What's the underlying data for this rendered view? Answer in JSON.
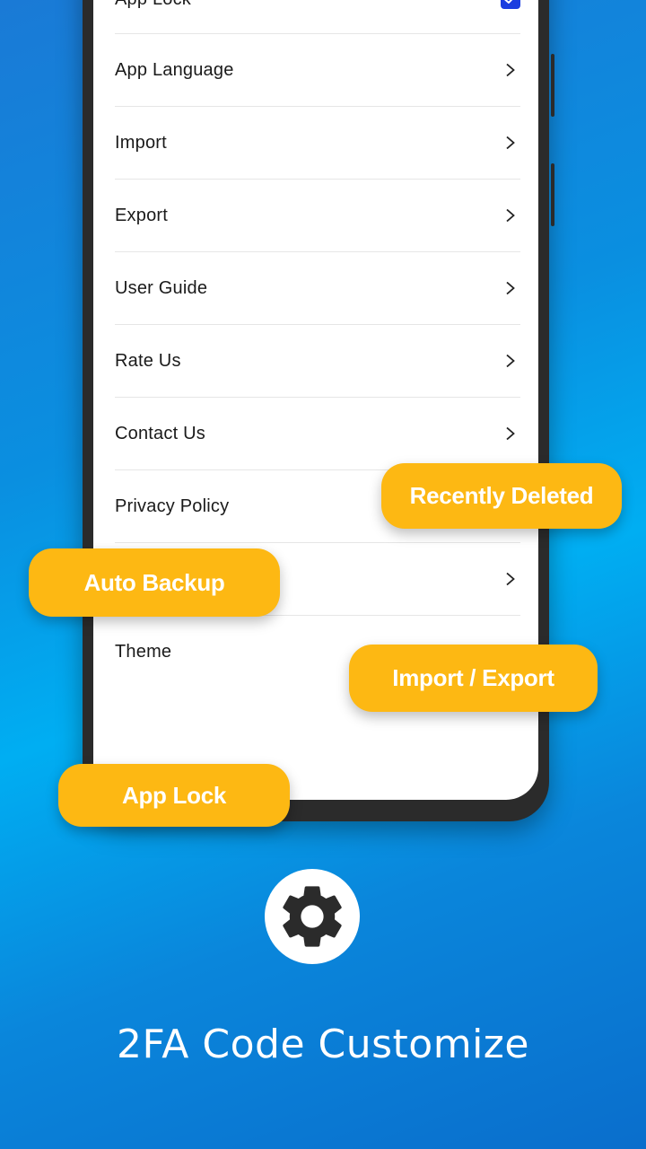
{
  "settings": {
    "items": [
      {
        "label": "App Lock",
        "control": "checkbox",
        "checked": true
      },
      {
        "label": "App Language",
        "control": "chevron"
      },
      {
        "label": "Import",
        "control": "chevron"
      },
      {
        "label": "Export",
        "control": "chevron"
      },
      {
        "label": "User Guide",
        "control": "chevron"
      },
      {
        "label": "Rate Us",
        "control": "chevron"
      },
      {
        "label": "Contact Us",
        "control": "chevron"
      },
      {
        "label": "Privacy Policy",
        "control": "none"
      },
      {
        "label": "",
        "control": "chevron"
      },
      {
        "label": "Theme",
        "control": "none"
      }
    ]
  },
  "callouts": {
    "recently_deleted": "Recently Deleted",
    "auto_backup": "Auto Backup",
    "import_export": "Import / Export",
    "app_lock": "App Lock"
  },
  "feature_icon": "gear-icon",
  "caption": "2FA Code Customize",
  "colors": {
    "callout": "#fdb813",
    "checkbox": "#1b3ee0",
    "background": "#0a8fe0"
  }
}
